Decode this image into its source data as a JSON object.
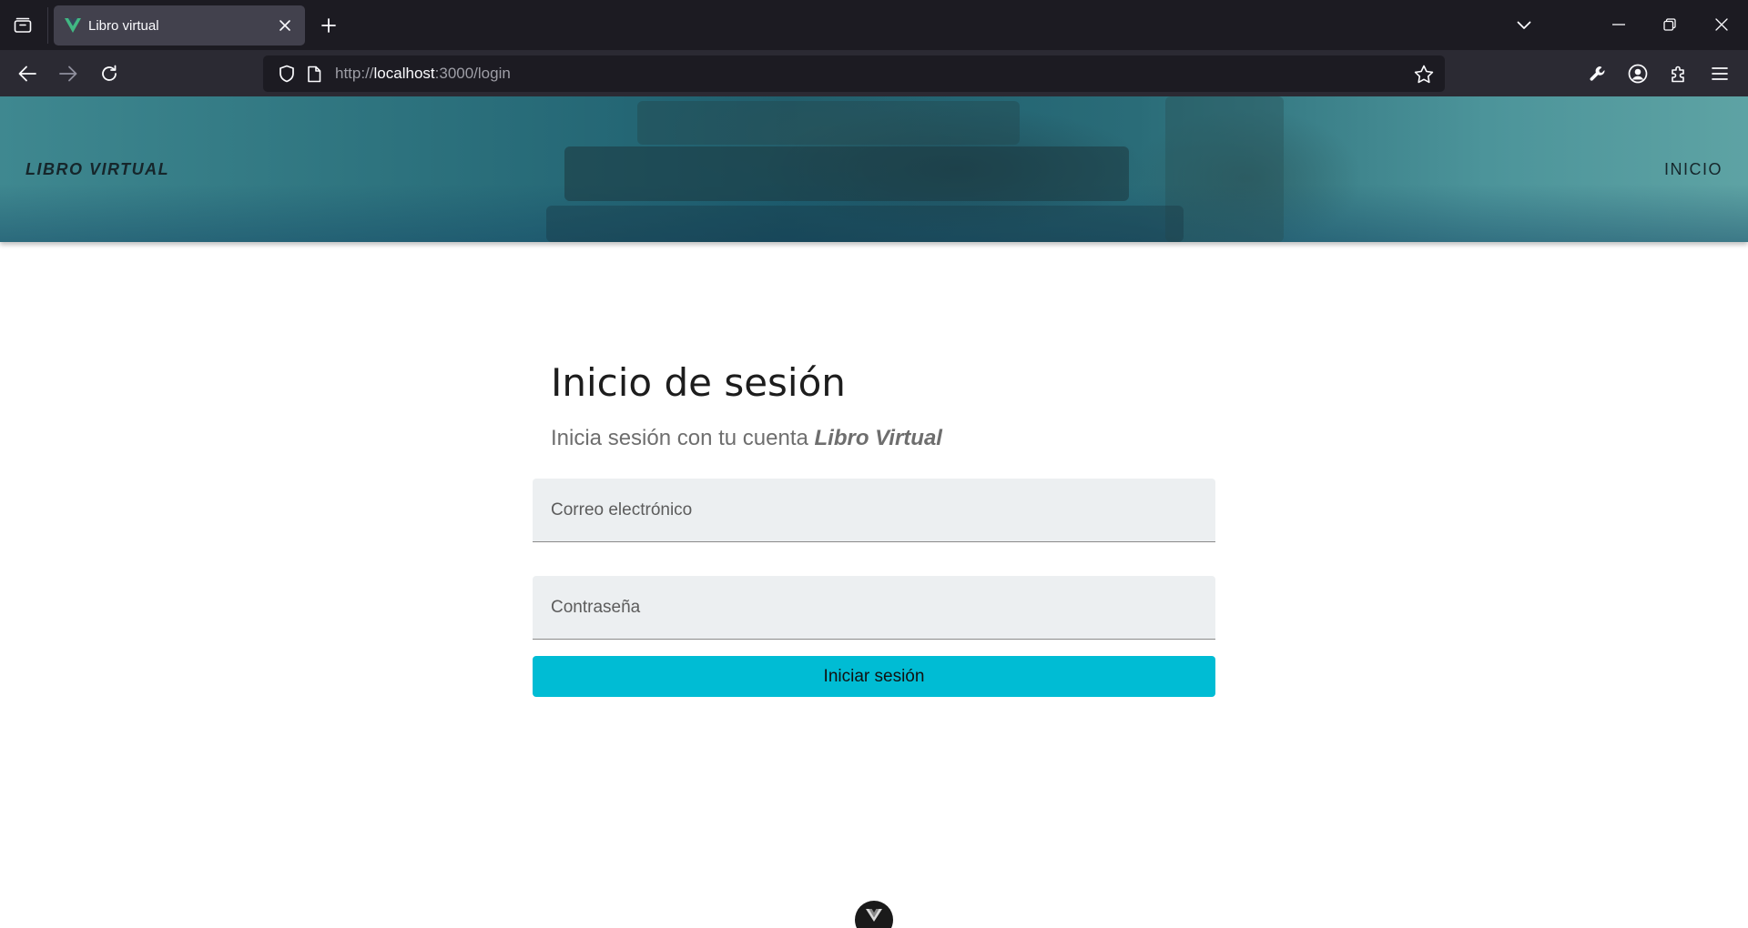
{
  "browser": {
    "tab_title": "Libro virtual",
    "url_scheme": "http://",
    "url_host": "localhost",
    "url_rest": ":3000/login",
    "colors": {
      "tabbar": "#1c1b22",
      "navbar": "#2b2a33",
      "active_tab": "#42414d"
    }
  },
  "header": {
    "brand": "LIBRO VIRTUAL",
    "nav_link": "INICIO"
  },
  "login": {
    "title": "Inicio de sesión",
    "subtitle_prefix": "Inicia sesión con tu cuenta ",
    "subtitle_brand": "Libro Virtual",
    "email_label": "Correo electrónico",
    "password_label": "Contraseña",
    "submit_label": "Iniciar sesión",
    "accent_color": "#00bcd4"
  },
  "icons": [
    "tab-overview-icon",
    "vue-favicon-icon",
    "close-icon",
    "plus-icon",
    "chevron-down-icon",
    "minimize-icon",
    "restore-icon",
    "window-close-icon",
    "back-arrow-icon",
    "forward-arrow-icon",
    "reload-icon",
    "shield-icon",
    "page-icon",
    "star-icon",
    "wrench-icon",
    "account-icon",
    "extensions-icon",
    "menu-icon",
    "vue-devtools-icon"
  ]
}
